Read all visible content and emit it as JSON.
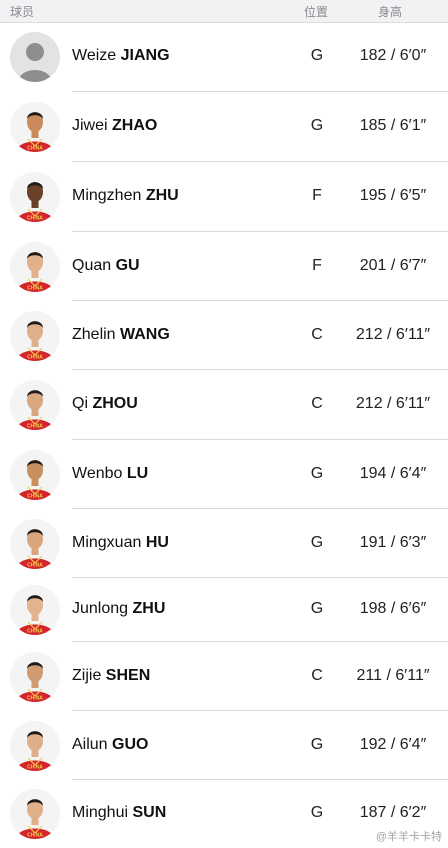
{
  "header": {
    "player": "球员",
    "position": "位置",
    "height": "身高"
  },
  "players": [
    {
      "first": "Weize",
      "last": "JIANG",
      "position": "G",
      "height": "182 / 6′0″",
      "avatar": "placeholder-avatar-icon"
    },
    {
      "first": "Jiwei",
      "last": "ZHAO",
      "position": "G",
      "height": "185 / 6′1″",
      "avatar": "player-photo"
    },
    {
      "first": "Mingzhen",
      "last": "ZHU",
      "position": "F",
      "height": "195 / 6′5″",
      "avatar": "player-photo"
    },
    {
      "first": "Quan",
      "last": "GU",
      "position": "F",
      "height": "201 / 6′7″",
      "avatar": "player-photo"
    },
    {
      "first": "Zhelin",
      "last": "WANG",
      "position": "C",
      "height": "212 / 6′11″",
      "avatar": "player-photo"
    },
    {
      "first": "Qi",
      "last": "ZHOU",
      "position": "C",
      "height": "212 / 6′11″",
      "avatar": "player-photo"
    },
    {
      "first": "Wenbo",
      "last": "LU",
      "position": "G",
      "height": "194 / 6′4″",
      "avatar": "player-photo"
    },
    {
      "first": "Mingxuan",
      "last": "HU",
      "position": "G",
      "height": "191 / 6′3″",
      "avatar": "player-photo"
    },
    {
      "first": "Junlong",
      "last": "ZHU",
      "position": "G",
      "height": "198 / 6′6″",
      "avatar": "player-photo"
    },
    {
      "first": "Zijie",
      "last": "SHEN",
      "position": "C",
      "height": "211 / 6′11″",
      "avatar": "player-photo"
    },
    {
      "first": "Ailun",
      "last": "GUO",
      "position": "G",
      "height": "192 / 6′4″",
      "avatar": "player-photo"
    },
    {
      "first": "Minghui",
      "last": "SUN",
      "position": "G",
      "height": "187 / 6′2″",
      "avatar": "player-photo"
    }
  ],
  "jersey_text": "CHINA",
  "watermark": "@羊羊卡卡特",
  "colors": {
    "jersey_red": "#d4252b",
    "jersey_gold": "#f2c94c",
    "header_bg": "#f2f2f4",
    "divider": "#d9d9d9"
  }
}
